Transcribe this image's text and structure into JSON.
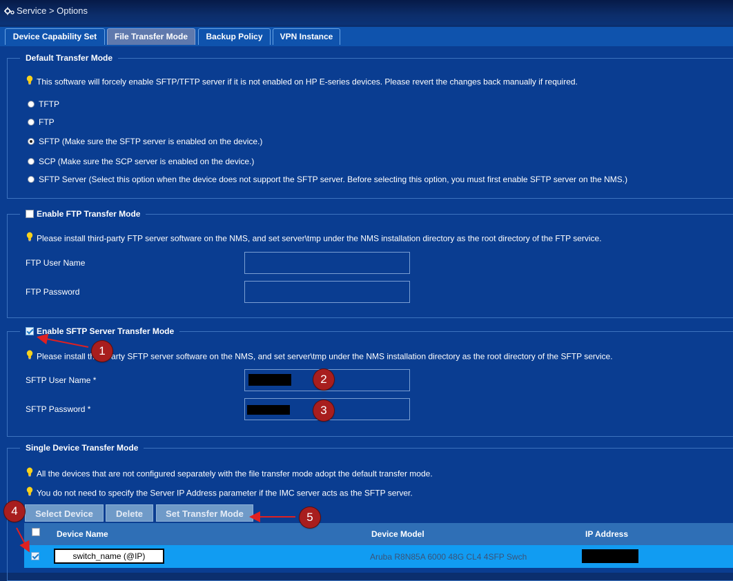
{
  "breadcrumb": {
    "text": "Service > Options",
    "icon": "gear-icon"
  },
  "tabs": [
    {
      "label": "Device Capability Set",
      "active": false
    },
    {
      "label": "File Transfer Mode",
      "active": true
    },
    {
      "label": "Backup Policy",
      "active": false
    },
    {
      "label": "VPN Instance",
      "active": false
    }
  ],
  "default_transfer": {
    "legend": "Default Transfer Mode",
    "note": "This software will forcely enable SFTP/TFTP server if it is not enabled on HP E-series devices. Please revert the changes back manually if required.",
    "options": [
      {
        "label": "TFTP",
        "checked": false
      },
      {
        "label": "FTP",
        "checked": false
      },
      {
        "label": "SFTP (Make sure the SFTP server is enabled on the device.)",
        "checked": true
      },
      {
        "label": "SCP (Make sure the SCP server is enabled on the device.)",
        "checked": false
      },
      {
        "label": "SFTP Server (Select this option when the device does not support the SFTP server. Before selecting this option, you must first enable SFTP server on the NMS.)",
        "checked": false
      }
    ]
  },
  "ftp": {
    "legend": "Enable FTP Transfer Mode",
    "enabled": false,
    "note": "Please install third-party FTP server software on the NMS, and set server\\tmp under the NMS installation directory as the root directory of the FTP service.",
    "user_label": "FTP User Name",
    "password_label": "FTP Password",
    "user_value": "",
    "password_value": ""
  },
  "sftp": {
    "legend": "Enable SFTP Server Transfer Mode",
    "enabled": true,
    "note": "Please install third-party SFTP server software on the NMS, and set server\\tmp under the NMS installation directory as the root directory of the SFTP service.",
    "user_label": "SFTP User Name *",
    "password_label": "SFTP Password *"
  },
  "single_device": {
    "legend": "Single Device Transfer Mode",
    "notes": [
      "All the devices that are not configured separately with the file transfer mode adopt the default transfer mode.",
      "You do not need to specify the Server IP Address parameter if the IMC server acts as the SFTP server."
    ],
    "buttons": {
      "select": "Select Device",
      "delete": "Delete",
      "set_mode": "Set Transfer Mode"
    },
    "table": {
      "columns": [
        "Device Name",
        "Device Model",
        "IP Address"
      ],
      "rows": [
        {
          "selected": true,
          "device_name": "switch_name (@IP)",
          "device_model": "Aruba R8N85A 6000 48G CL4 4SFP Swch",
          "ip_address": ""
        }
      ]
    }
  },
  "annotations": [
    "1",
    "2",
    "3",
    "4",
    "5"
  ],
  "colors": {
    "background": "#0a3d91",
    "tab_bar": "#0f53ad",
    "active_tab": "#5f79ad",
    "table_header": "#2f6fb6",
    "selected_row": "#119cf2",
    "marker": "#a81e1e",
    "arrow": "#e02020"
  }
}
